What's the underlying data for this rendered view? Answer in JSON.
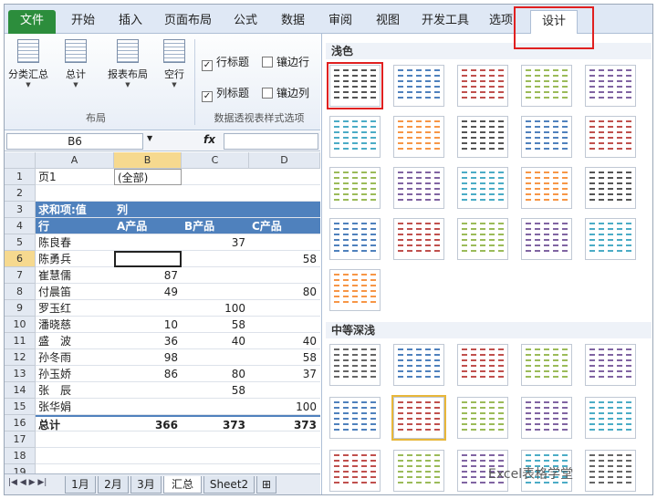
{
  "ribbon_tabs": [
    "文件",
    "开始",
    "插入",
    "页面布局",
    "公式",
    "数据",
    "审阅",
    "视图",
    "开发工具",
    "选项",
    "设计"
  ],
  "ribbon": {
    "buttons": [
      "分类汇总",
      "总计",
      "报表布局",
      "空行"
    ],
    "group_layout": "布局",
    "checkboxes": [
      {
        "label": "行标题",
        "checked": true
      },
      {
        "label": "镶边行",
        "checked": false
      },
      {
        "label": "列标题",
        "checked": true
      },
      {
        "label": "镶边列",
        "checked": false
      }
    ],
    "group_style_options": "数据透视表样式选项"
  },
  "formula_bar": {
    "name_box": "B6",
    "fx": "fx",
    "value": ""
  },
  "columns": [
    "A",
    "B",
    "C",
    "D"
  ],
  "rows": [
    {
      "n": "1",
      "a": "页1",
      "b": "(全部)",
      "c": "",
      "d": ""
    },
    {
      "n": "2",
      "a": "",
      "b": "",
      "c": "",
      "d": ""
    },
    {
      "n": "3",
      "a": "求和项:值",
      "b": "列",
      "c": "",
      "d": ""
    },
    {
      "n": "4",
      "a": "行",
      "b": "A产品",
      "c": "B产品",
      "d": "C产品"
    },
    {
      "n": "5",
      "a": "陈良春",
      "b": "",
      "c": "37",
      "d": ""
    },
    {
      "n": "6",
      "a": "陈勇兵",
      "b": "",
      "c": "",
      "d": "58"
    },
    {
      "n": "7",
      "a": "崔慧儒",
      "b": "87",
      "c": "",
      "d": ""
    },
    {
      "n": "8",
      "a": "付晨笛",
      "b": "49",
      "c": "",
      "d": "80"
    },
    {
      "n": "9",
      "a": "罗玉红",
      "b": "",
      "c": "100",
      "d": ""
    },
    {
      "n": "10",
      "a": "潘晓慈",
      "b": "10",
      "c": "58",
      "d": ""
    },
    {
      "n": "11",
      "a": "盛　波",
      "b": "36",
      "c": "40",
      "d": "40"
    },
    {
      "n": "12",
      "a": "孙冬雨",
      "b": "98",
      "c": "",
      "d": "58"
    },
    {
      "n": "13",
      "a": "孙玉娇",
      "b": "86",
      "c": "80",
      "d": "37"
    },
    {
      "n": "14",
      "a": "张　辰",
      "b": "",
      "c": "58",
      "d": ""
    },
    {
      "n": "15",
      "a": "张华娟",
      "b": "",
      "c": "",
      "d": "100"
    },
    {
      "n": "16",
      "a": "总计",
      "b": "366",
      "c": "373",
      "d": "373"
    },
    {
      "n": "17",
      "a": "",
      "b": "",
      "c": "",
      "d": ""
    },
    {
      "n": "18",
      "a": "",
      "b": "",
      "c": "",
      "d": ""
    },
    {
      "n": "19",
      "a": "",
      "b": "",
      "c": "",
      "d": ""
    }
  ],
  "sheet_tabs": [
    "1月",
    "2月",
    "3月",
    "汇总",
    "Sheet2"
  ],
  "gallery": {
    "section_light": "浅色",
    "section_medium": "中等深浅",
    "light_colors": [
      "#555555",
      "#4f81bd",
      "#c0504d",
      "#9bbb59",
      "#8064a2",
      "#4bacc6",
      "#f79646"
    ],
    "medium_colors": [
      "#666666",
      "#4f81bd",
      "#c0504d",
      "#9bbb59",
      "#8064a2",
      "#4bacc6"
    ]
  },
  "watermark": "Excel表格学堂"
}
